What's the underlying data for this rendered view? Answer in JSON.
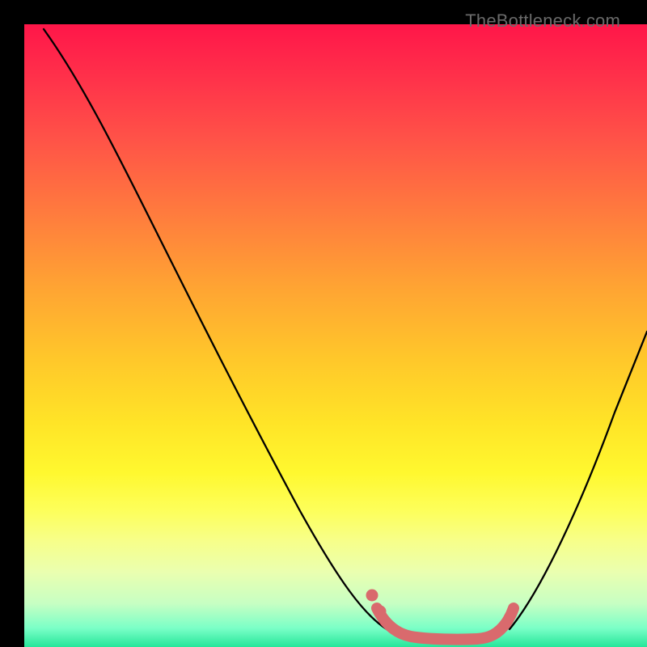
{
  "watermark": "TheBottleneck.com",
  "colors": {
    "curve_thin": "#000000",
    "curve_highlight": "#d96a6d",
    "gradient_top": "#ff1649",
    "gradient_bottom": "#25e69a"
  },
  "chart_data": {
    "type": "line",
    "title": "",
    "xlabel": "",
    "ylabel": "",
    "xlim": [
      0,
      100
    ],
    "ylim": [
      0,
      100
    ],
    "grid": false,
    "legend": false,
    "note": "Axes have no tick labels in the source image; x/y are normalized 0–100. Lower y = better (bottom of plot).",
    "series": [
      {
        "name": "left-branch",
        "style": "thin-black",
        "x": [
          3,
          10,
          18,
          26,
          34,
          42,
          50,
          55,
          58
        ],
        "y": [
          98,
          86,
          72,
          58,
          44,
          30,
          16,
          7,
          3
        ]
      },
      {
        "name": "right-branch",
        "style": "thin-black",
        "x": [
          78,
          84,
          90,
          96,
          100
        ],
        "y": [
          3,
          12,
          26,
          40,
          50
        ]
      },
      {
        "name": "valley-highlight",
        "style": "thick-salmon",
        "x": [
          56,
          58,
          60,
          63,
          67,
          71,
          74,
          76,
          78
        ],
        "y": [
          6,
          2,
          1,
          0.5,
          0.5,
          0.5,
          1,
          2,
          5
        ]
      },
      {
        "name": "left-dots",
        "style": "salmon-dots",
        "x": [
          55.5,
          57
        ],
        "y": [
          8,
          4
        ]
      }
    ]
  }
}
